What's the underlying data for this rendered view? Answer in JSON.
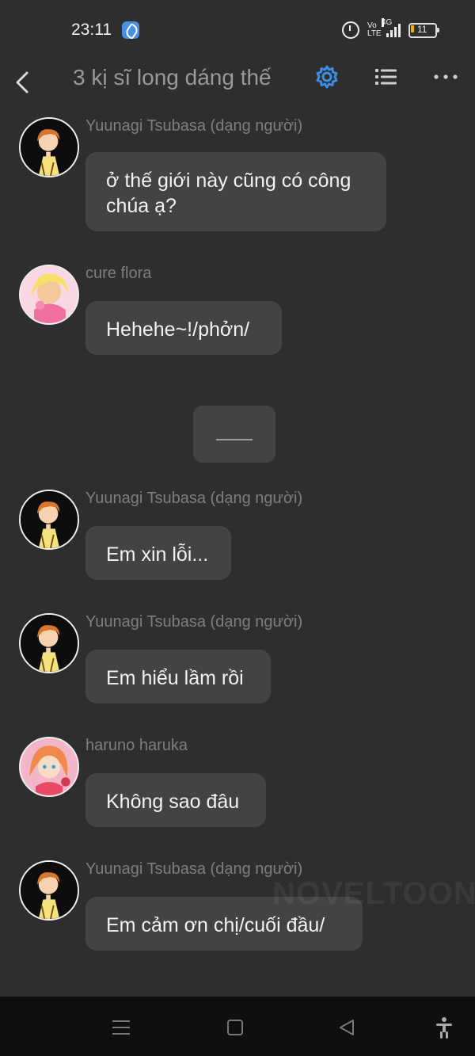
{
  "status_bar": {
    "time": "23:11",
    "network": "4G",
    "volte": "Vo LTE",
    "battery": "11",
    "icons": [
      "app-notification-icon",
      "alarm-icon",
      "volte-icon",
      "signal-icon",
      "battery-icon"
    ]
  },
  "header": {
    "title": "3 kị sĩ long dáng thế",
    "accent_color": "#3a8ee6",
    "icons": [
      "back-arrow-icon",
      "gear-icon",
      "list-icon",
      "more-icon"
    ]
  },
  "messages": [
    {
      "sender": "Yuunagi Tsubasa (dạng người)",
      "text": "ở thế giới này cũng có công chúa ạ?",
      "avatar": "tsubasa-avatar"
    },
    {
      "sender": "cure flora",
      "text": "Hehehe~!/phởn/",
      "avatar": "cure-flora-avatar"
    },
    {
      "sender": "",
      "text": "",
      "avatar": ""
    },
    {
      "sender": "Yuunagi Tsubasa (dạng người)",
      "text": "Em xin lỗi...",
      "avatar": "tsubasa-avatar"
    },
    {
      "sender": "Yuunagi Tsubasa (dạng người)",
      "text": "Em hiểu lầm rồi",
      "avatar": "tsubasa-avatar"
    },
    {
      "sender": "haruno haruka",
      "text": "Không sao đâu",
      "avatar": "haruka-avatar"
    },
    {
      "sender": "Yuunagi Tsubasa (dạng người)",
      "text": "Em cảm ơn chị/cuối đầu/",
      "avatar": "tsubasa-avatar"
    }
  ],
  "watermark": "NOVELTOON",
  "nav_bar": {
    "icons": [
      "menu-icon",
      "home-square-icon",
      "back-triangle-icon",
      "accessibility-icon"
    ]
  }
}
